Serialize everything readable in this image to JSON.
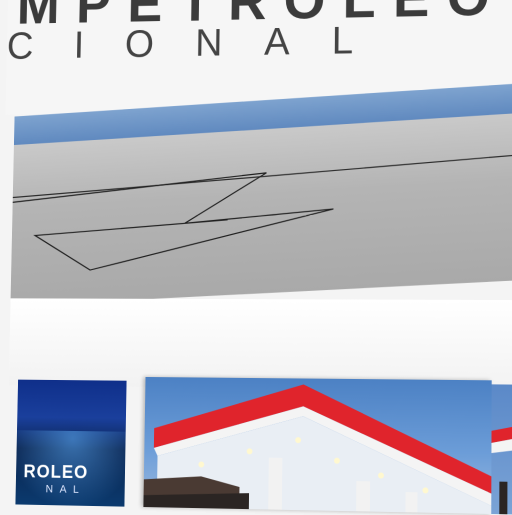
{
  "logo": {
    "wordmark": "MPETROLEO",
    "subline": "CIONAL"
  },
  "thumbnails": {
    "left": {
      "brand_text": "ROLEO",
      "sub_text": "NAL"
    },
    "main": {
      "alt": "gas station canopy"
    }
  },
  "colors": {
    "accent_blue": "#5c86bd",
    "canopy_red": "#d8222b",
    "panel_gray": "#b4b4b4"
  }
}
